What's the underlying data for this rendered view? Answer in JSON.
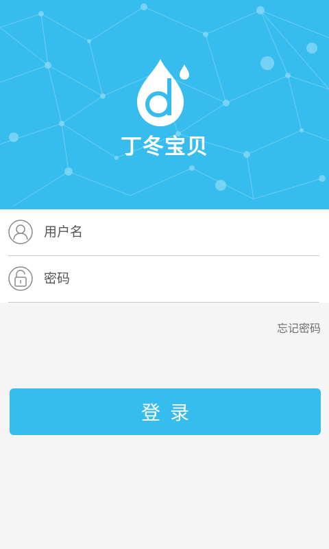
{
  "app": {
    "brand_name": "丁冬宝贝",
    "accent_color": "#36bdee"
  },
  "login_form": {
    "username": {
      "placeholder": "用户名",
      "value": "",
      "icon": "user-icon"
    },
    "password": {
      "placeholder": "密码",
      "value": "",
      "icon": "lock-icon"
    },
    "forgot_password_label": "忘记密码",
    "login_button_label": "登录"
  }
}
